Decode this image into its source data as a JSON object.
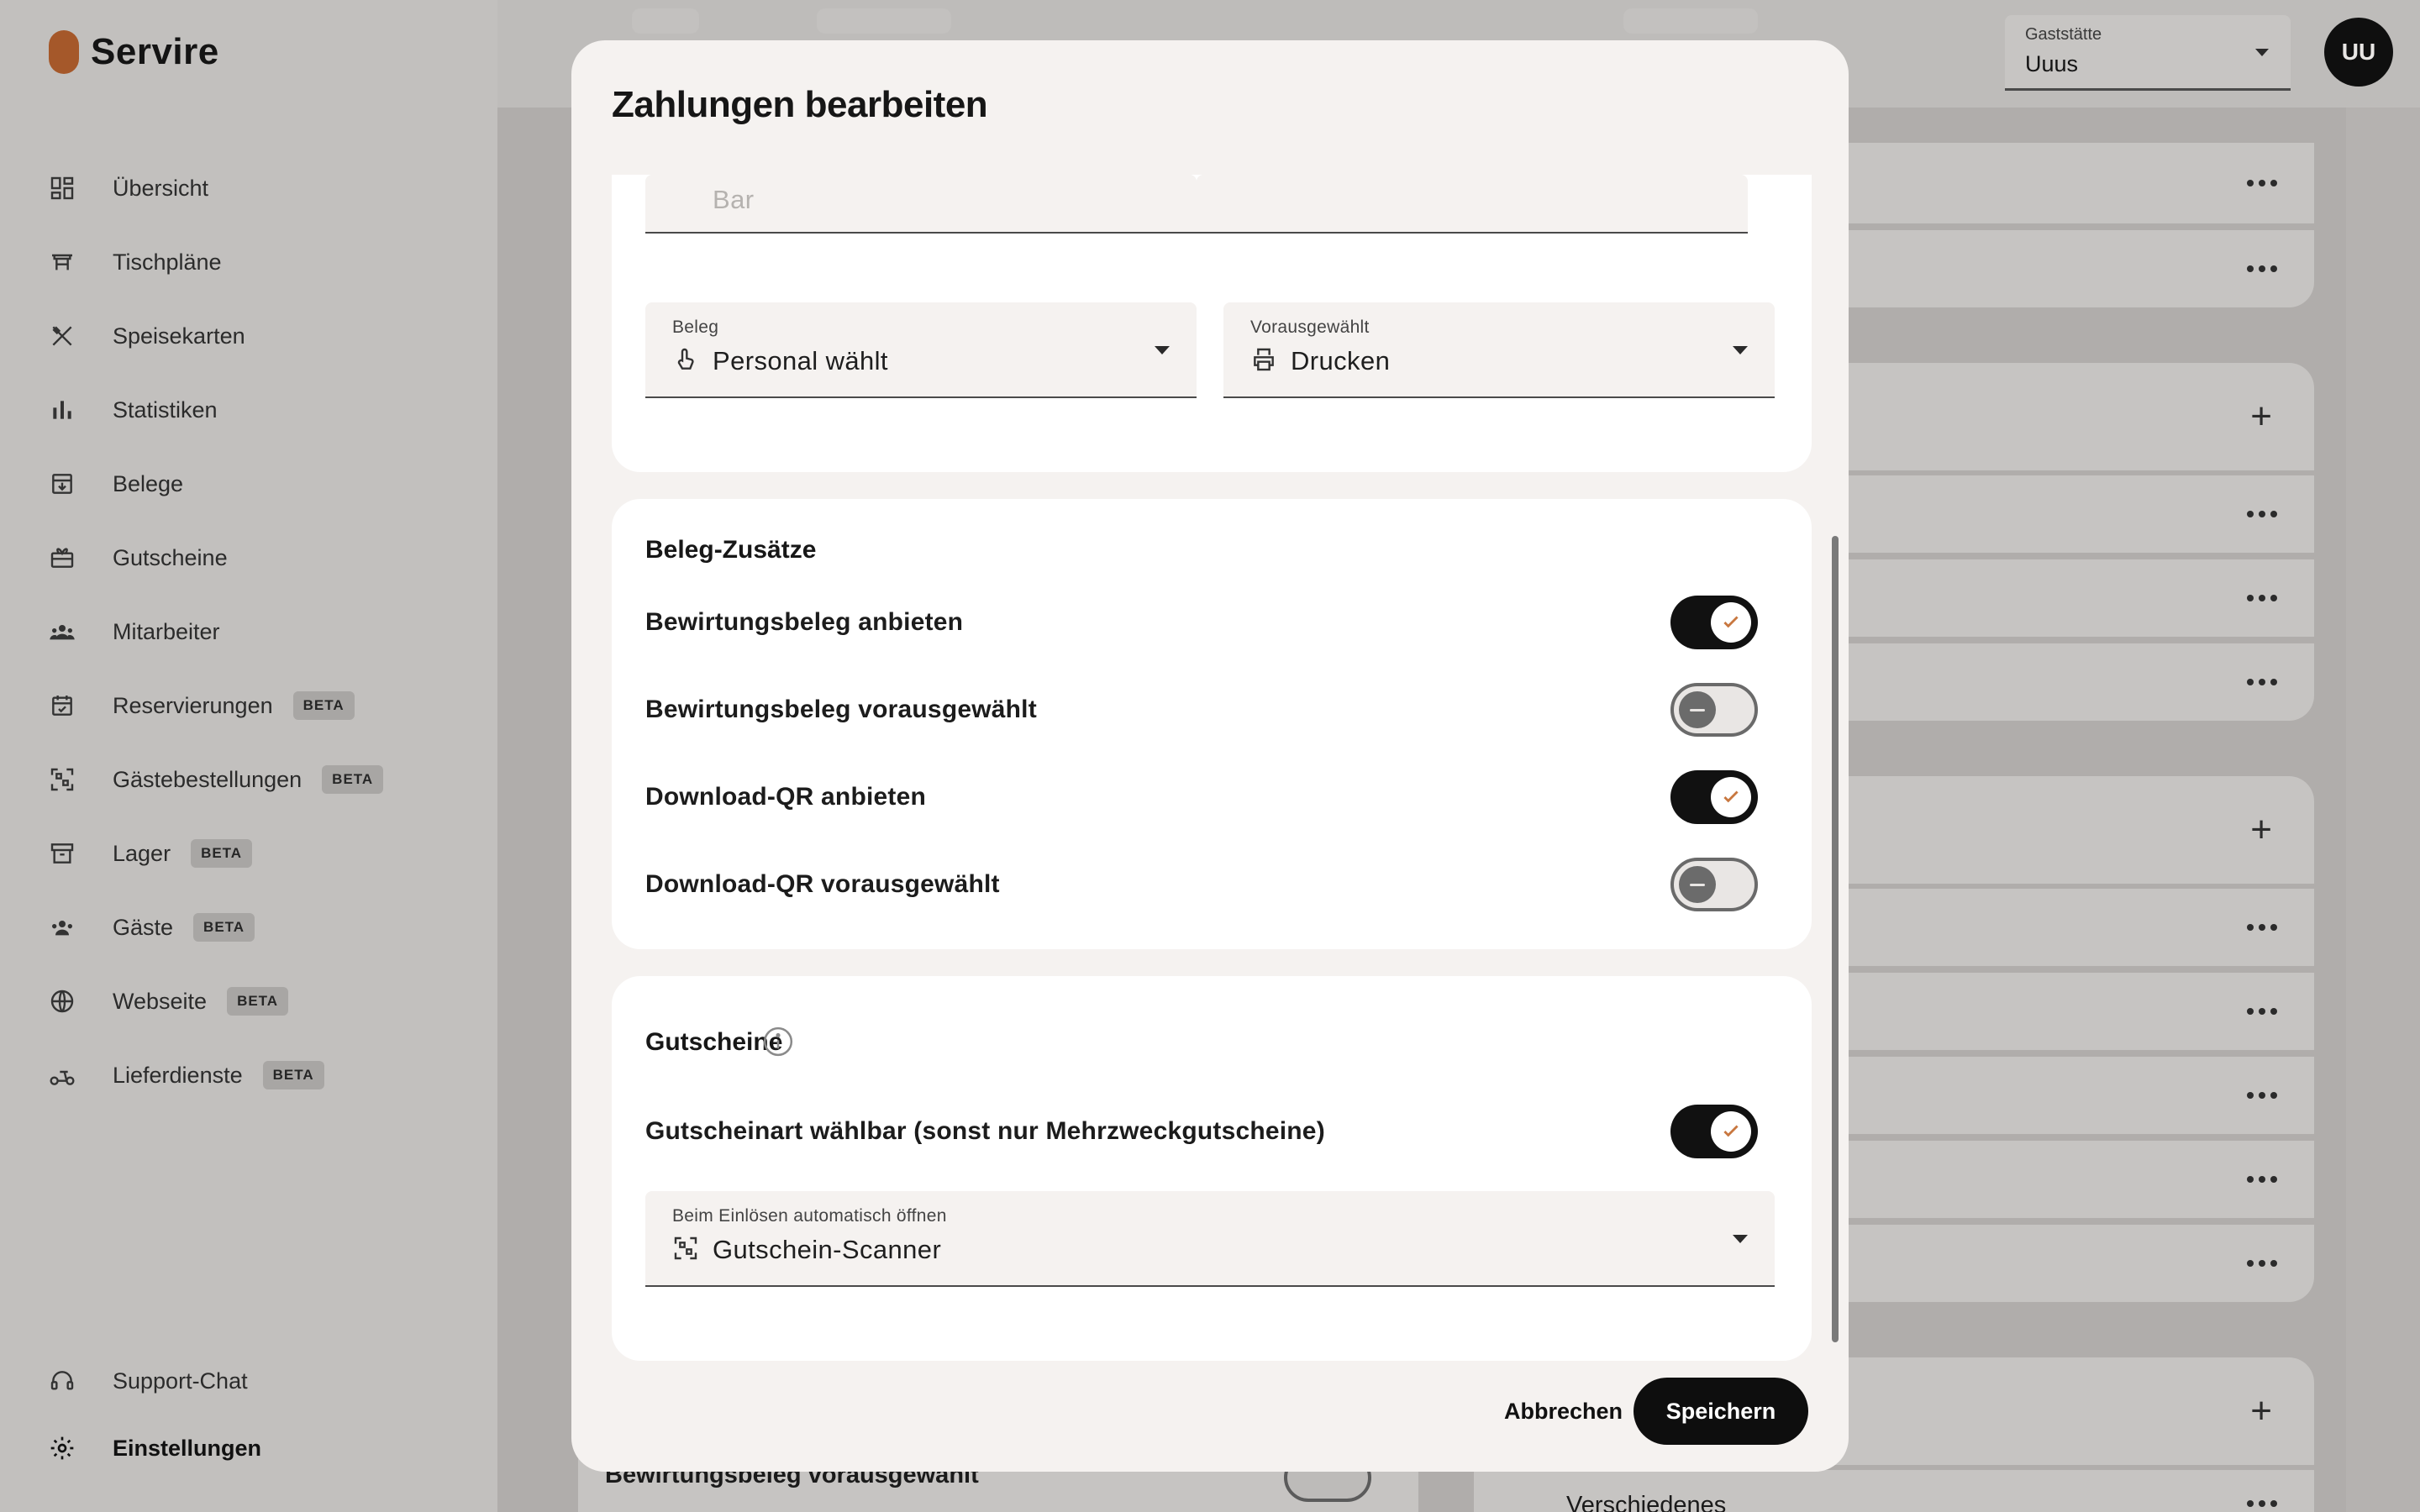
{
  "app": {
    "name": "Servire",
    "nav": [
      {
        "label": "Übersicht",
        "icon": "dashboard-icon",
        "beta": ""
      },
      {
        "label": "Tischpläne",
        "icon": "table-icon",
        "beta": ""
      },
      {
        "label": "Speisekarten",
        "icon": "cutlery-icon",
        "beta": ""
      },
      {
        "label": "Statistiken",
        "icon": "bar-chart-icon",
        "beta": ""
      },
      {
        "label": "Belege",
        "icon": "receipt-box-icon",
        "beta": ""
      },
      {
        "label": "Gutscheine",
        "icon": "gift-card-icon",
        "beta": ""
      },
      {
        "label": "Mitarbeiter",
        "icon": "people-icon",
        "beta": ""
      },
      {
        "label": "Reservierungen",
        "icon": "calendar-check-icon",
        "beta": "BETA"
      },
      {
        "label": "Gästebestellungen",
        "icon": "qr-scan-icon",
        "beta": "BETA"
      },
      {
        "label": "Lager",
        "icon": "archive-icon",
        "beta": "BETA"
      },
      {
        "label": "Gäste",
        "icon": "guests-icon",
        "beta": "BETA"
      },
      {
        "label": "Webseite",
        "icon": "globe-icon",
        "beta": "BETA"
      },
      {
        "label": "Lieferdienste",
        "icon": "scooter-icon",
        "beta": "BETA"
      }
    ],
    "nav_bottom": [
      {
        "label": "Support-Chat",
        "icon": "headset-icon"
      },
      {
        "label": "Einstellungen",
        "icon": "gear-icon"
      }
    ],
    "gaststaette": {
      "label": "Gaststätte",
      "value": "Uuus"
    },
    "avatar": "UU",
    "background_left_text": "Bewirtungsbeleg vorausgewählt",
    "background_right_text": "Verschiedenes"
  },
  "modal": {
    "title": "Zahlungen bearbeiten",
    "top_field_value": "Bar",
    "beleg": {
      "label": "Beleg",
      "value": "Personal wählt",
      "icon": "hand-pointer-icon"
    },
    "vorausgewaehlt": {
      "label": "Vorausgewählt",
      "value": "Drucken",
      "icon": "printer-icon"
    },
    "zusaetze": {
      "title": "Beleg-Zusätze",
      "toggles": [
        {
          "label": "Bewirtungsbeleg anbieten",
          "on": true
        },
        {
          "label": "Bewirtungsbeleg vorausgewählt",
          "on": false
        },
        {
          "label": "Download-QR anbieten",
          "on": true
        },
        {
          "label": "Download-QR vorausgewählt",
          "on": false
        }
      ]
    },
    "gutscheine": {
      "title": "Gutscheine",
      "toggle_label": "Gutscheinart wählbar (sonst nur Mehrzweckgutscheine)",
      "toggle_on": true,
      "field_label": "Beim Einlösen automatisch öffnen",
      "field_value": "Gutschein-Scanner",
      "field_icon": "qr-scan-icon"
    },
    "cancel_label": "Abbrechen",
    "save_label": "Speichern"
  },
  "colors": {
    "accent": "#c8773f",
    "brand": "#a5582a",
    "primary": "#0e0e0e"
  }
}
